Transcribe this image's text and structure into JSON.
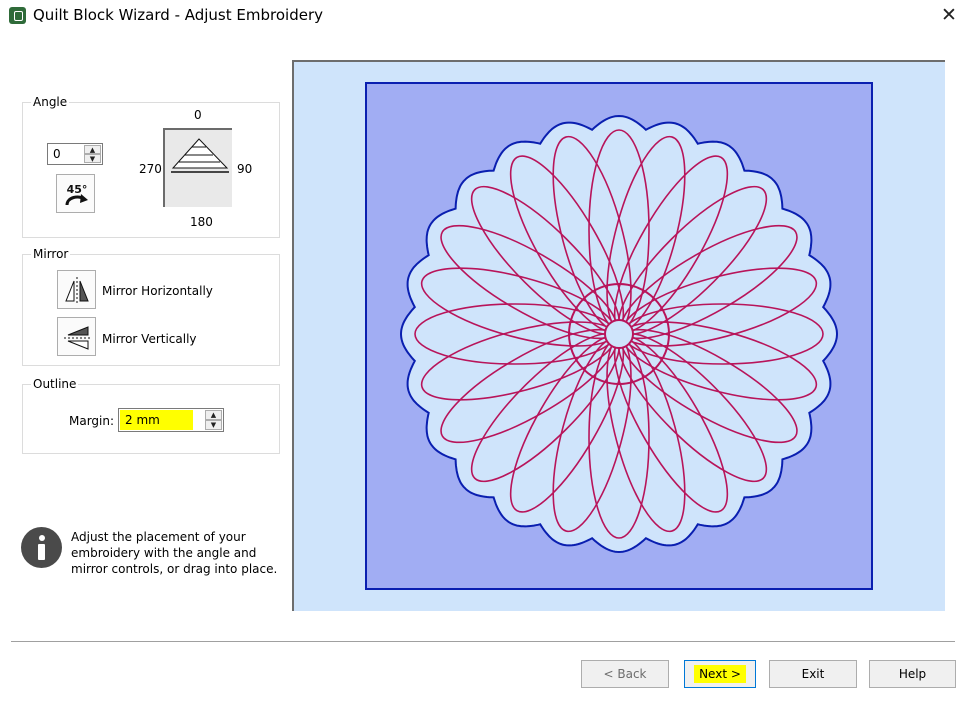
{
  "window": {
    "title": "Quilt Block Wizard - Adjust Embroidery",
    "close_symbol": "✕",
    "app_icon": "app-icon"
  },
  "angle": {
    "label": "Angle",
    "value": "0",
    "rotate_45_icon": "rotate-45-icon",
    "rotate_45_text": "45°",
    "dial_labels": {
      "top": "0",
      "right": "90",
      "bottom": "180",
      "left": "270"
    }
  },
  "mirror": {
    "label": "Mirror",
    "horizontal_label": "Mirror Horizontally",
    "vertical_label": "Mirror Vertically"
  },
  "outline": {
    "label": "Outline",
    "margin_label": "Margin:",
    "margin_value": "2 mm"
  },
  "info": {
    "text": "Adjust the placement of your embroidery with the angle and mirror controls, or drag into place."
  },
  "buttons": {
    "back": "< Back",
    "next": "Next >",
    "exit": "Exit",
    "help": "Help"
  },
  "colors": {
    "preview_background": "#cfe4fb",
    "block_fill": "#a1adf3",
    "block_border": "#0a1fb0",
    "outline_stroke": "#0a1fb0",
    "stitch_color": "#b8145a",
    "highlight": "#ffff00"
  }
}
